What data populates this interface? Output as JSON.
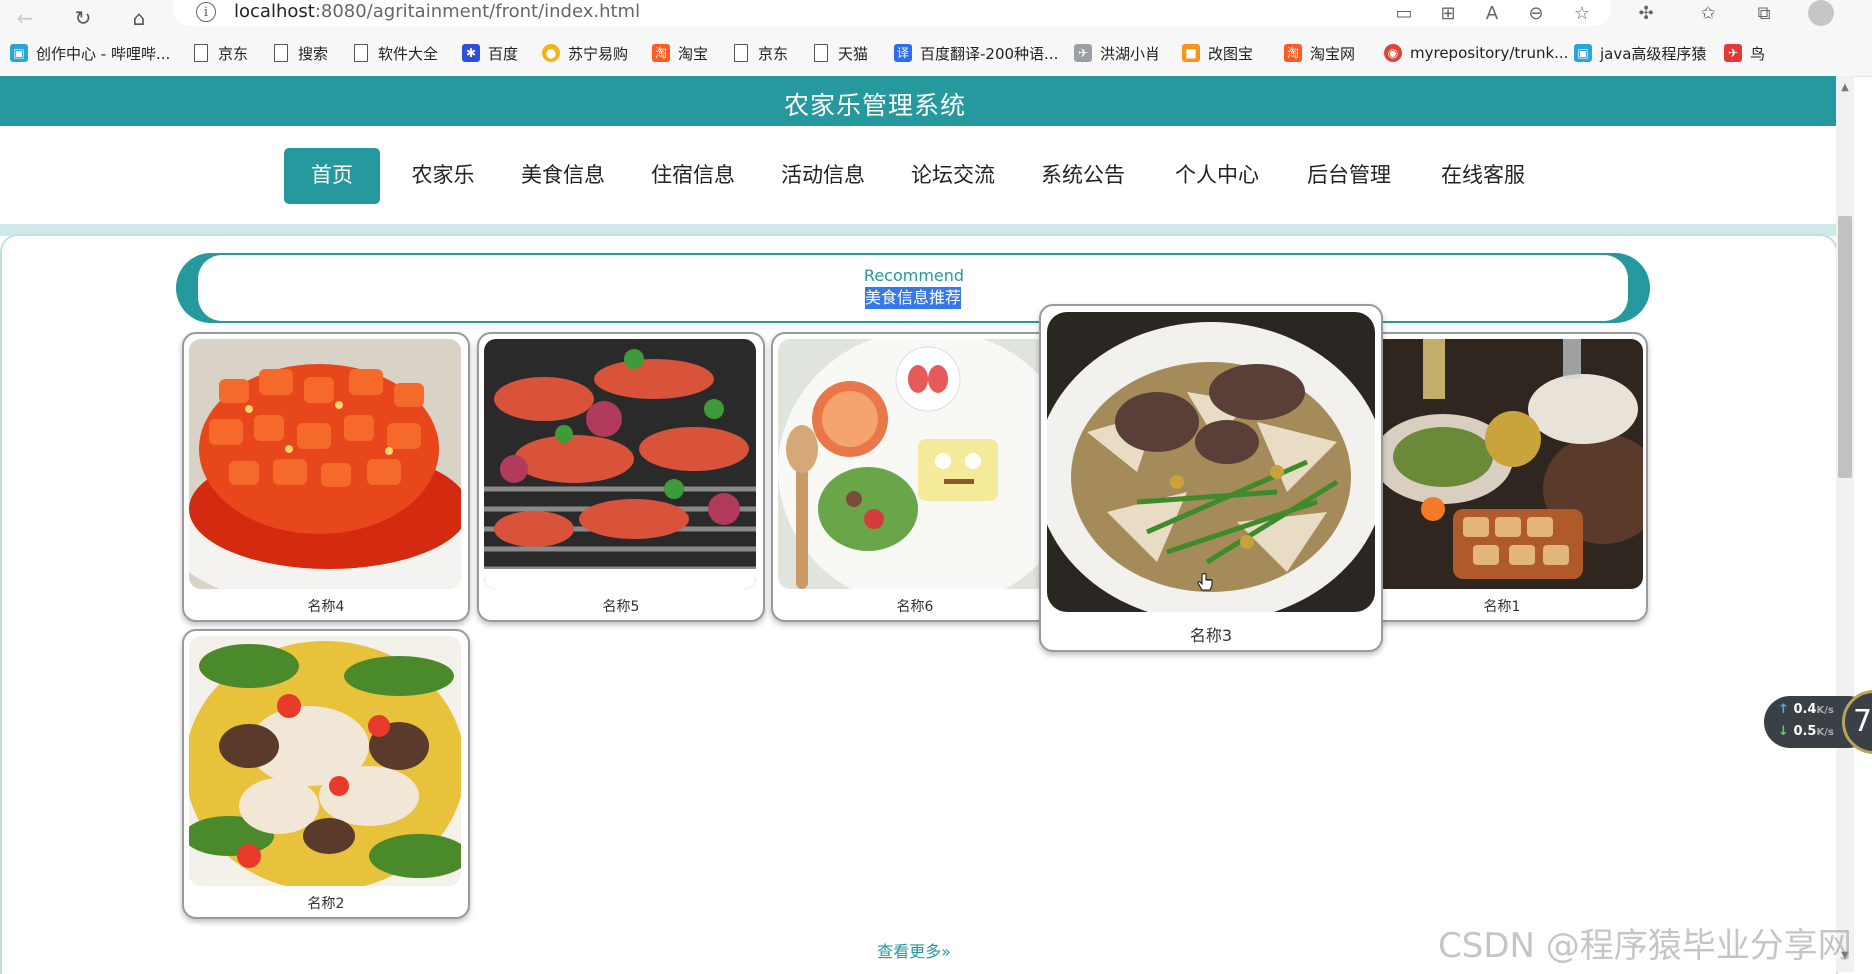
{
  "browser": {
    "url_host": "localhost",
    "url_rest": ":8080/agritainment/front/index.html",
    "bookmarks": [
      {
        "label": "创作中心 - 哔哩哔...",
        "icon": "bilibili-icon"
      },
      {
        "label": "京东",
        "icon": "page-icon"
      },
      {
        "label": "搜索",
        "icon": "page-icon"
      },
      {
        "label": "软件大全",
        "icon": "page-icon"
      },
      {
        "label": "百度",
        "icon": "baidu-icon"
      },
      {
        "label": "苏宁易购",
        "icon": "suning-icon"
      },
      {
        "label": "淘宝",
        "icon": "taobao-icon"
      },
      {
        "label": "京东",
        "icon": "page-icon"
      },
      {
        "label": "天猫",
        "icon": "page-icon"
      },
      {
        "label": "百度翻译-200种语...",
        "icon": "translate-icon"
      },
      {
        "label": "洪湖小肖",
        "icon": "bird-icon"
      },
      {
        "label": "改图宝",
        "icon": "image-edit-icon"
      },
      {
        "label": "淘宝网",
        "icon": "taobao-icon"
      },
      {
        "label": "myrepository/trunk...",
        "icon": "chrome-icon"
      },
      {
        "label": "java高级程序猿",
        "icon": "bilibili-icon"
      },
      {
        "label": "鸟",
        "icon": "bird-icon"
      }
    ]
  },
  "site": {
    "title": "农家乐管理系统",
    "menu": [
      "首页",
      "农家乐",
      "美食信息",
      "住宿信息",
      "活动信息",
      "论坛交流",
      "系统公告",
      "个人中心",
      "后台管理",
      "在线客服"
    ]
  },
  "recommend": {
    "en": "Recommend",
    "cn": "美食信息推荐",
    "items": [
      {
        "name": "名称4",
        "image": "sweet-and-sour-fish"
      },
      {
        "name": "名称5",
        "image": "grilled-seafood"
      },
      {
        "name": "名称6",
        "image": "breakfast-plate"
      },
      {
        "name": "名称3",
        "image": "beef-noodle-soup"
      },
      {
        "name": "名称1",
        "image": "table-spread"
      },
      {
        "name": "名称2",
        "image": "mushroom-chicken-soup"
      }
    ],
    "more_label": "查看更多"
  },
  "speed_widget": {
    "up": "0.4",
    "down": "0.5",
    "unit": "K/s",
    "ring": "7"
  },
  "watermark": "CSDN @程序猿毕业分享网"
}
